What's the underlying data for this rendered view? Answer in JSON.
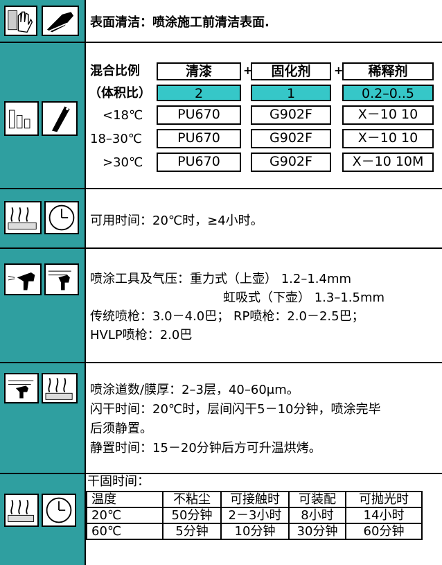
{
  "section1": {
    "text": "表面清洁：喷涂施工前清洁表面."
  },
  "mix": {
    "label1": "混合比例",
    "label2": "（体积比）",
    "headers": [
      "清漆",
      "固化剂",
      "稀释剂"
    ],
    "plus": "+",
    "ratios": [
      "2",
      "1",
      "0.2–0..5"
    ],
    "rows": [
      {
        "temp": "<18℃",
        "a": "PU670",
        "b": "G902F",
        "c": "X－10  10"
      },
      {
        "temp": "18–30℃",
        "a": "PU670",
        "b": "G902F",
        "c": "X－10  10"
      },
      {
        "temp": ">30℃",
        "a": "PU670",
        "b": "G902F",
        "c": "X－10  10M"
      }
    ]
  },
  "potlife": {
    "text": "可用时间：20℃时，≥4小时。"
  },
  "spray": {
    "line1": "喷涂工具及气压：重力式（上壶）   1.2–1.4mm",
    "line2": "虹吸式（下壶）   1.3–1.5mm",
    "line3": "传统喷枪：3.0－4.0巴；  RP喷枪：2.0－2.5巴；",
    "line4": "HVLP喷枪：2.0巴"
  },
  "coats": {
    "line1": "喷涂道数/膜厚：2–3层，40–60μm。",
    "line2": "闪干时间：20℃时，层间闪干5－10分钟，喷涂完毕",
    "line3": "后须静置。",
    "line4": "静置时间：15－20分钟后方可升温烘烤。"
  },
  "drying": {
    "title": "干固时间：",
    "headers": [
      "温度",
      "不粘尘",
      "可接触时",
      "可装配",
      "可抛光时"
    ],
    "rows": [
      [
        "20℃",
        "50分钟",
        "2－3小时",
        "8小时",
        "14小时"
      ],
      [
        "60℃",
        "5分钟",
        "10分钟",
        "30分钟",
        "60分钟"
      ]
    ]
  },
  "colors": {
    "sidebar": "#2f9fa0",
    "ratio_fill": "#36c7c8"
  }
}
